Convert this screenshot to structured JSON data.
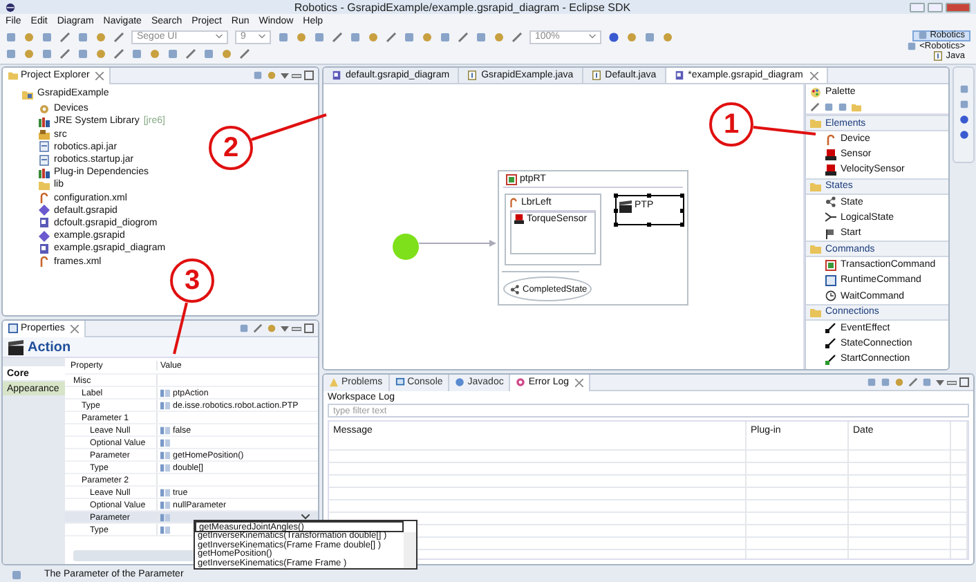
{
  "window": {
    "title": "Robotics - GsrapidExample/example.gsrapid_diagram - Eclipse SDK"
  },
  "menu": [
    "File",
    "Edit",
    "Diagram",
    "Navigate",
    "Search",
    "Project",
    "Run",
    "Window",
    "Help"
  ],
  "toolbar": {
    "font": "Segoe UI",
    "size": "9",
    "zoom": "100%"
  },
  "perspectives": [
    {
      "label": "Robotics",
      "selected": true
    },
    {
      "label": "<Robotics>",
      "selected": false
    },
    {
      "label": "Java",
      "selected": false
    }
  ],
  "project_explorer": {
    "title": "Project Explorer",
    "tree": [
      {
        "label": "GsrapidExample",
        "kind": "project",
        "children": [
          {
            "label": "Devices",
            "kind": "gear"
          },
          {
            "label": "JRE System Library",
            "suffix": "[jre6]",
            "kind": "library"
          },
          {
            "label": "src",
            "kind": "package"
          },
          {
            "label": "robotics.api.jar",
            "kind": "jar"
          },
          {
            "label": "robotics.startup.jar",
            "kind": "jar"
          },
          {
            "label": "Plug-in Dependencies",
            "kind": "library"
          },
          {
            "label": "lib",
            "kind": "folder"
          },
          {
            "label": "configuration.xml",
            "kind": "hook"
          },
          {
            "label": "default.gsrapid",
            "kind": "diamond"
          },
          {
            "label": "dcfoult.gsrapid_diogrom",
            "kind": "diagram"
          },
          {
            "label": "example.gsrapid",
            "kind": "diamond"
          },
          {
            "label": "example.gsrapid_diagram",
            "kind": "diagram"
          },
          {
            "label": "frames.xml",
            "kind": "hook"
          }
        ]
      }
    ]
  },
  "properties": {
    "title": "Properties",
    "heading": "Action",
    "tabs": [
      {
        "label": "Core",
        "selected": true
      },
      {
        "label": "Appearance",
        "selected": false
      }
    ],
    "columns": [
      "Property",
      "Value"
    ],
    "rows": [
      {
        "property": "Misc",
        "selected": false,
        "children": [
          {
            "property": "Label",
            "value": "ptpAction",
            "selected": false
          },
          {
            "property": "Type",
            "value": "de.isse.robotics.robot.action.PTP",
            "selected": false
          },
          {
            "property": "Parameter 1",
            "selected": false,
            "children": [
              {
                "property": "Leave Null",
                "value": "false",
                "selected": false
              },
              {
                "property": "Optional Value",
                "selected": false
              },
              {
                "property": "Parameter",
                "value": "getHomePosition()",
                "selected": false
              },
              {
                "property": "Type",
                "value": "double[]",
                "selected": false
              }
            ]
          },
          {
            "property": "Parameter 2",
            "selected": false,
            "children": [
              {
                "property": "Leave Null",
                "value": "true",
                "selected": false
              },
              {
                "property": "Optional Value",
                "value": "nullParameter",
                "selected": false
              },
              {
                "property": "Parameter",
                "selected": true
              },
              {
                "property": "Type",
                "selected": false
              }
            ]
          }
        ]
      }
    ],
    "dropdown": {
      "value": "getMeasuredJointAngles()",
      "options": [
        "getInverseKinematics(Transformation double[] )",
        "getInverseKinematics(Frame Frame double[] )",
        "getHomePosition()",
        "getInverseKinematics(Frame Frame )"
      ]
    }
  },
  "editor": {
    "tabs": [
      {
        "label": "default.gsrapid_diagram",
        "kind": "diagram",
        "selected": false
      },
      {
        "label": "GsrapidExample.java",
        "kind": "java",
        "selected": false
      },
      {
        "label": "Default.java",
        "kind": "java",
        "selected": false
      },
      {
        "label": "*example.gsrapid_diagram",
        "kind": "diagram",
        "selected": true
      }
    ],
    "diagram": {
      "container": "ptpRT",
      "region": "LbrLeft",
      "sensor": "TorqueSensor",
      "action": {
        "label": "PTP",
        "selected": true
      },
      "final_state": "CompletedState"
    }
  },
  "palette": {
    "title": "Palette",
    "groups": [
      {
        "label": "Elements",
        "items": [
          {
            "label": "Device",
            "kind": "hook"
          },
          {
            "label": "Sensor",
            "kind": "sensor"
          },
          {
            "label": "VelocitySensor",
            "kind": "sensor"
          }
        ]
      },
      {
        "label": "States",
        "items": [
          {
            "label": "State",
            "kind": "state"
          },
          {
            "label": "LogicalState",
            "kind": "logic"
          },
          {
            "label": "Start",
            "kind": "flag"
          }
        ]
      },
      {
        "label": "Commands",
        "items": [
          {
            "label": "TransactionCommand",
            "kind": "square"
          },
          {
            "label": "RuntimeCommand",
            "kind": "box"
          },
          {
            "label": "WaitCommand",
            "kind": "clock"
          }
        ]
      },
      {
        "label": "Connections",
        "items": [
          {
            "label": "EventEffect",
            "kind": "connector"
          },
          {
            "label": "StateConnection",
            "kind": "connector"
          },
          {
            "label": "StartConnection",
            "kind": "green-connector"
          }
        ]
      }
    ]
  },
  "error_log": {
    "tabs": [
      {
        "label": "Problems",
        "selected": false
      },
      {
        "label": "Console",
        "selected": false
      },
      {
        "label": "Javadoc",
        "selected": false
      },
      {
        "label": "Error Log",
        "selected": true
      }
    ],
    "heading": "Workspace Log",
    "filter": {
      "placeholder": "type filter text"
    },
    "columns": [
      "Message",
      "Plug-in",
      "Date"
    ]
  },
  "status_bar": {
    "text": "The Parameter of the Parameter"
  },
  "callouts": [
    {
      "label": "1"
    },
    {
      "label": "2"
    },
    {
      "label": "3"
    }
  ]
}
